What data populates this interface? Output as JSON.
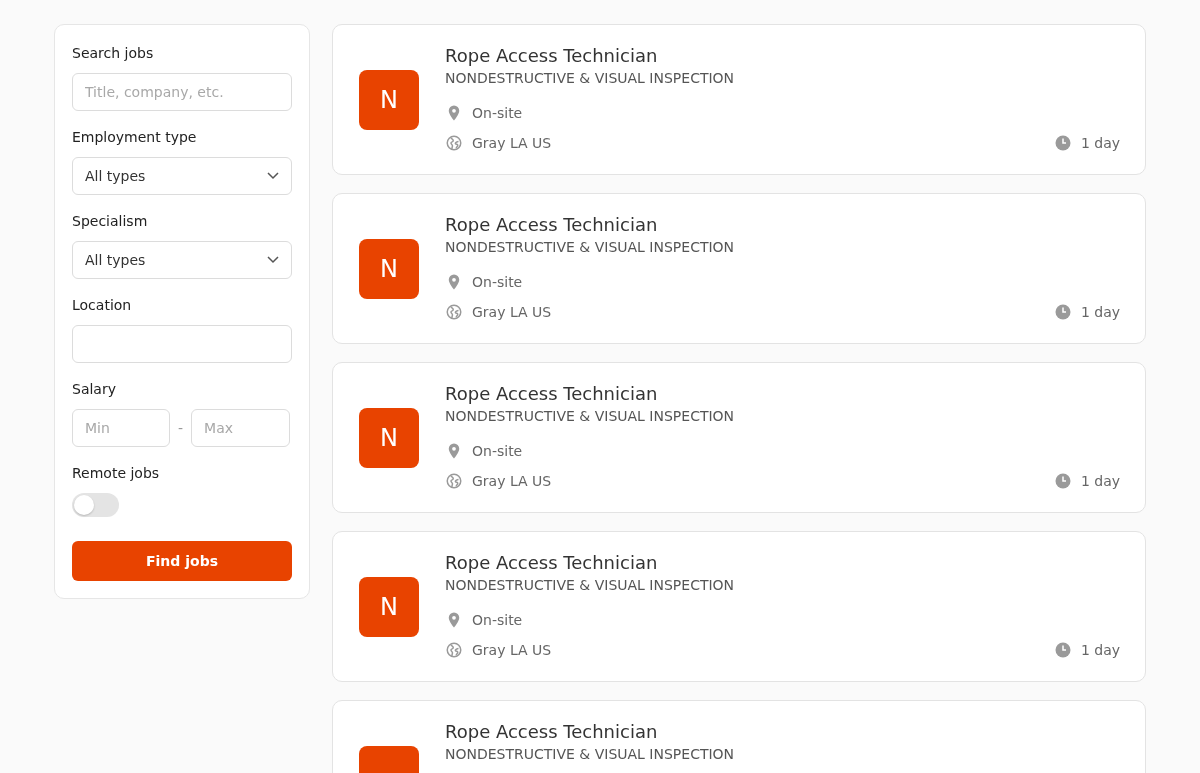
{
  "filters": {
    "search": {
      "label": "Search jobs",
      "placeholder": "Title, company, etc."
    },
    "employment_type": {
      "label": "Employment type",
      "value": "All types"
    },
    "specialism": {
      "label": "Specialism",
      "value": "All types"
    },
    "location": {
      "label": "Location"
    },
    "salary": {
      "label": "Salary",
      "min_placeholder": "Min",
      "separator": "-",
      "max_placeholder": "Max"
    },
    "remote": {
      "label": "Remote jobs",
      "on": false
    },
    "button": "Find jobs"
  },
  "jobs": [
    {
      "logo": "N",
      "title": "Rope Access Technician",
      "company": "NONDESTRUCTIVE & VISUAL INSPECTION",
      "workplace": "On-site",
      "location": "Gray LA US",
      "posted": "1 day"
    },
    {
      "logo": "N",
      "title": "Rope Access Technician",
      "company": "NONDESTRUCTIVE & VISUAL INSPECTION",
      "workplace": "On-site",
      "location": "Gray LA US",
      "posted": "1 day"
    },
    {
      "logo": "N",
      "title": "Rope Access Technician",
      "company": "NONDESTRUCTIVE & VISUAL INSPECTION",
      "workplace": "On-site",
      "location": "Gray LA US",
      "posted": "1 day"
    },
    {
      "logo": "N",
      "title": "Rope Access Technician",
      "company": "NONDESTRUCTIVE & VISUAL INSPECTION",
      "workplace": "On-site",
      "location": "Gray LA US",
      "posted": "1 day"
    },
    {
      "title": "Rope Access Technician",
      "company": "NONDESTRUCTIVE & VISUAL INSPECTION"
    }
  ]
}
